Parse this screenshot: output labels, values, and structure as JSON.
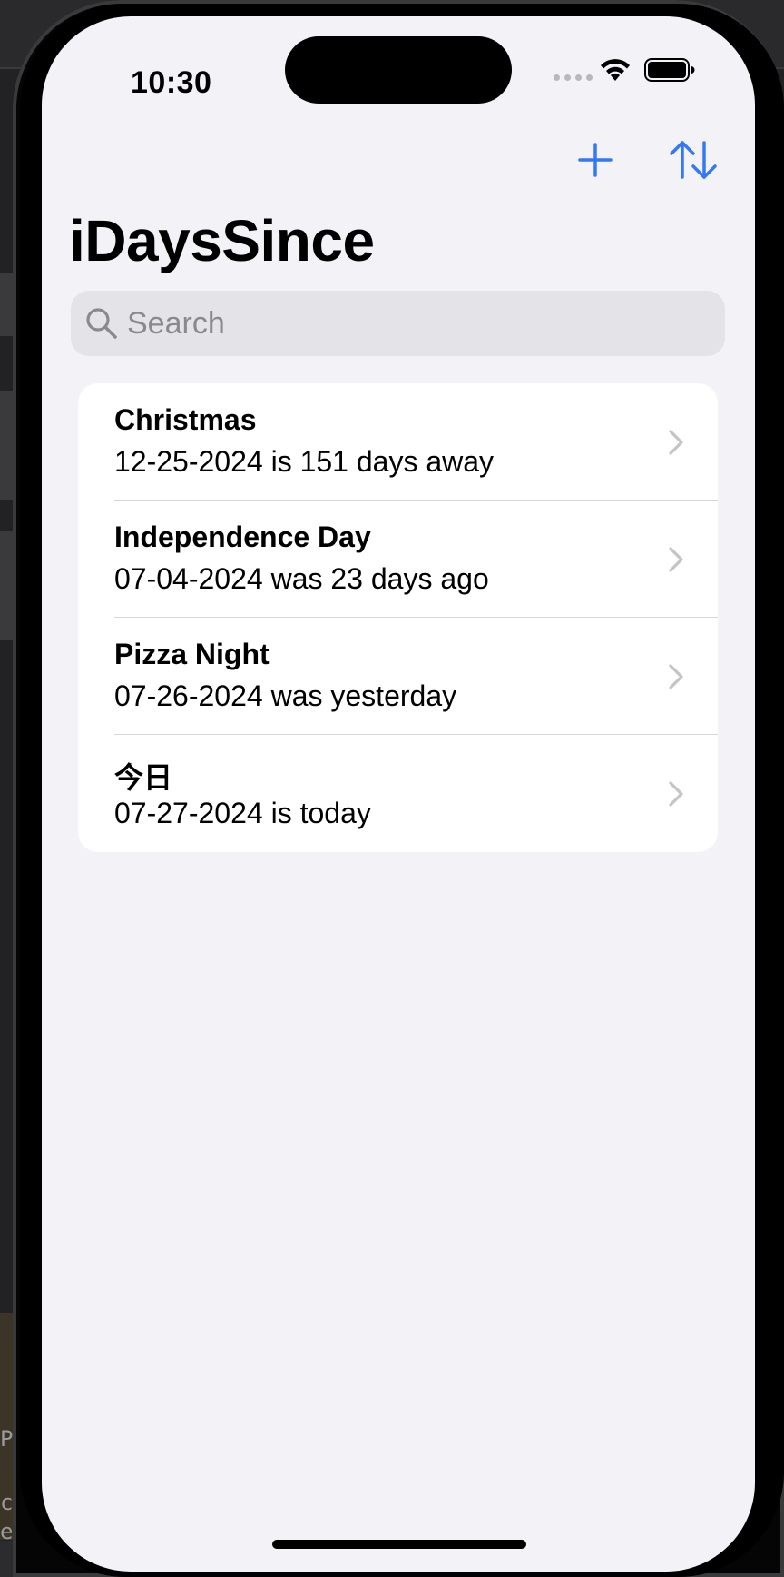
{
  "status_bar": {
    "time": "10:30"
  },
  "nav": {
    "title": "iDaysSince",
    "add_icon": "plus-icon",
    "sort_icon": "sort-arrows-icon",
    "accent_color": "#3478f6"
  },
  "search": {
    "placeholder": "Search",
    "value": ""
  },
  "events": [
    {
      "title": "Christmas",
      "subtitle": "12-25-2024 is 151 days away"
    },
    {
      "title": "Independence Day",
      "subtitle": "07-04-2024 was 23 days ago"
    },
    {
      "title": "Pizza Night",
      "subtitle": "07-26-2024 was yesterday"
    },
    {
      "title": "今日",
      "subtitle": "07-27-2024 is today"
    }
  ],
  "host_window": {
    "fragment_1": "P",
    "fragment_2": "ch",
    "fragment_3": "ed"
  }
}
